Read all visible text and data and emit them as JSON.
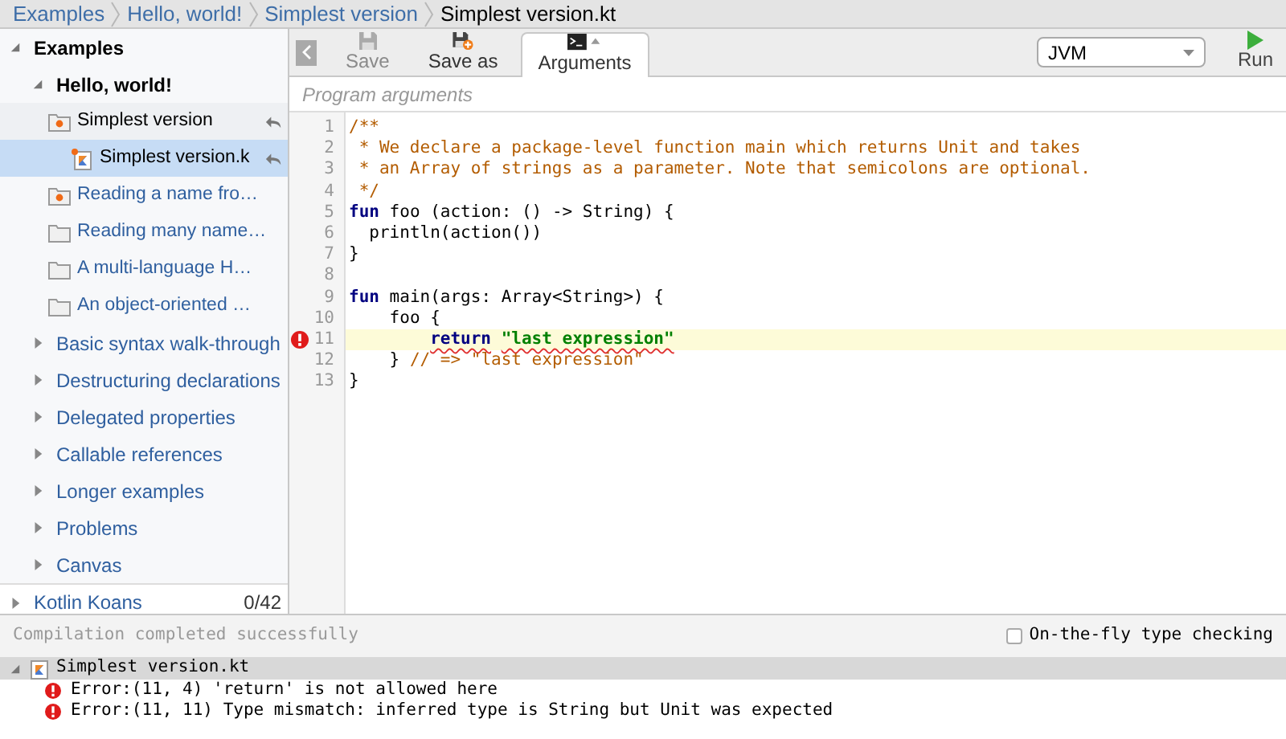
{
  "breadcrumbs": [
    {
      "label": "Examples",
      "current": false
    },
    {
      "label": "Hello, world!",
      "current": false
    },
    {
      "label": "Simplest version",
      "current": false
    },
    {
      "label": "Simplest version.kt",
      "current": true
    }
  ],
  "sidebar": {
    "tree": [
      {
        "kind": "group",
        "label": "Examples",
        "expanded": true,
        "children": [
          {
            "kind": "group",
            "label": "Hello, world!",
            "expanded": true,
            "children": [
              {
                "kind": "example",
                "label": "Simplest version",
                "modified": true,
                "revertable": true,
                "selected": false,
                "expanded": true,
                "children": [
                  {
                    "kind": "file",
                    "label": "Simplest version.k",
                    "modified": true,
                    "revertable": true,
                    "selected": true
                  }
                ]
              },
              {
                "kind": "example",
                "label": "Reading a name fro…",
                "modified": true,
                "revertable": false,
                "selected": false
              },
              {
                "kind": "example",
                "label": "Reading many name…",
                "modified": false,
                "revertable": false,
                "selected": false
              },
              {
                "kind": "example",
                "label": "A multi-language H…",
                "modified": false,
                "revertable": false,
                "selected": false
              },
              {
                "kind": "example",
                "label": "An object-oriented …",
                "modified": false,
                "revertable": false,
                "selected": false
              }
            ]
          },
          {
            "kind": "group",
            "label": "Basic syntax walk-through",
            "expanded": false
          },
          {
            "kind": "group",
            "label": "Destructuring declarations",
            "expanded": false
          },
          {
            "kind": "group",
            "label": "Delegated properties",
            "expanded": false
          },
          {
            "kind": "group",
            "label": "Callable references",
            "expanded": false
          },
          {
            "kind": "group",
            "label": "Longer examples",
            "expanded": false
          },
          {
            "kind": "group",
            "label": "Problems",
            "expanded": false
          },
          {
            "kind": "group",
            "label": "Canvas",
            "expanded": false
          }
        ]
      },
      {
        "kind": "group",
        "label": "Kotlin Koans",
        "expanded": false,
        "count": "0/42"
      }
    ]
  },
  "toolbar": {
    "buttons": [
      {
        "kind": "save",
        "label": "Save",
        "disabled": true,
        "selected": false
      },
      {
        "kind": "save_as",
        "label": "Save as",
        "disabled": false,
        "selected": false
      },
      {
        "kind": "arguments",
        "label": "Arguments",
        "disabled": false,
        "selected": true
      }
    ],
    "platform": {
      "value": "JVM"
    },
    "run": {
      "label": "Run"
    }
  },
  "arguments_field": {
    "placeholder": "Program arguments"
  },
  "editor": {
    "lines": [
      {
        "number": "1",
        "error": false,
        "tokens": [
          {
            "kind": "comment",
            "text": "/**"
          }
        ]
      },
      {
        "number": "2",
        "error": false,
        "tokens": [
          {
            "kind": "comment",
            "text": " * We declare a package-level function main which returns Unit and takes"
          }
        ]
      },
      {
        "number": "3",
        "error": false,
        "tokens": [
          {
            "kind": "comment",
            "text": " * an Array of strings as a parameter. Note that semicolons are optional."
          }
        ]
      },
      {
        "number": "4",
        "error": false,
        "tokens": [
          {
            "kind": "comment",
            "text": " */"
          }
        ]
      },
      {
        "number": "5",
        "error": false,
        "tokens": [
          {
            "kind": "keyword",
            "text": "fun"
          },
          {
            "kind": "plain",
            "text": " foo (action: () -> String) {"
          }
        ]
      },
      {
        "number": "6",
        "error": false,
        "tokens": [
          {
            "kind": "plain",
            "text": "  println(action())"
          }
        ]
      },
      {
        "number": "7",
        "error": false,
        "tokens": [
          {
            "kind": "plain",
            "text": "}"
          }
        ]
      },
      {
        "number": "8",
        "error": false
      },
      {
        "number": "9",
        "error": false,
        "tokens": [
          {
            "kind": "keyword",
            "text": "fun"
          },
          {
            "kind": "plain",
            "text": " main(args: Array<String>) {"
          }
        ]
      },
      {
        "number": "10",
        "error": false,
        "tokens": [
          {
            "kind": "plain",
            "text": "    foo {"
          }
        ]
      },
      {
        "number": "11",
        "error": true,
        "tokens": [
          {
            "kind": "keyword",
            "text": "        return",
            "squiggle": true
          },
          {
            "kind": "string",
            "text": " \"last expression\"",
            "squiggle": true
          }
        ]
      },
      {
        "number": "12",
        "error": false,
        "tokens": [
          {
            "kind": "plain",
            "text": "    } "
          },
          {
            "kind": "comment",
            "text": "// => \"last expression\""
          }
        ]
      },
      {
        "number": "13",
        "error": false,
        "tokens": [
          {
            "kind": "plain",
            "text": "}"
          }
        ]
      }
    ]
  },
  "status_bar": {
    "message": "Compilation completed successfully",
    "type_checking": {
      "label": "On-the-fly type checking",
      "checked": false
    }
  },
  "problems": {
    "file": "Simplest version.kt",
    "expanded": true,
    "errors": [
      "Error:(11, 4) 'return' is not allowed here",
      "Error:(11, 11) Type mismatch: inferred type is String but Unit was expected"
    ]
  }
}
